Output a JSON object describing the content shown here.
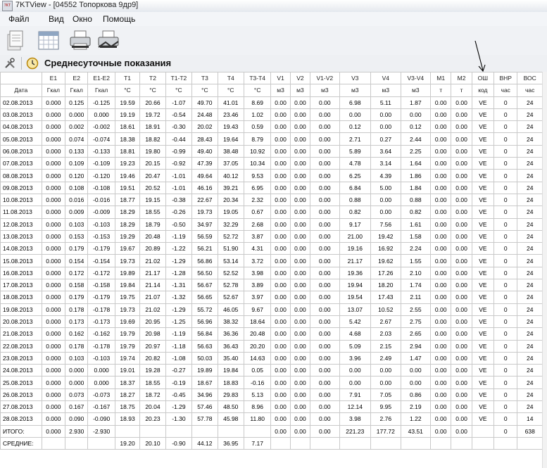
{
  "window": {
    "title": "7KTView - [04552 Топоркова 9др9]"
  },
  "menu": [
    "Файл",
    "Вид",
    "Окно",
    "Помощь"
  ],
  "toolbar": {
    "buttons": [
      "document-icon",
      "calendar-icon",
      "printer-icon",
      "print-preview-icon"
    ]
  },
  "report": {
    "title": "Среднесуточные показания"
  },
  "table": {
    "headers": [
      "",
      "E1",
      "E2",
      "E1-E2",
      "T1",
      "T2",
      "T1-T2",
      "T3",
      "T4",
      "T3-T4",
      "V1",
      "V2",
      "V1-V2",
      "V3",
      "V4",
      "V3-V4",
      "M1",
      "M2",
      "ОШ",
      "ВНР",
      "ВОС"
    ],
    "units": [
      "Дата",
      "Гкал",
      "Гкал",
      "Гкал",
      "°C",
      "°C",
      "°C",
      "°C",
      "°C",
      "°C",
      "м3",
      "м3",
      "м3",
      "м3",
      "м3",
      "м3",
      "т",
      "т",
      "код",
      "час",
      "час"
    ],
    "rows": [
      [
        "02.08.2013",
        "0.000",
        "0.125",
        "-0.125",
        "19.59",
        "20.66",
        "-1.07",
        "49.70",
        "41.01",
        "8.69",
        "0.00",
        "0.00",
        "0.00",
        "6.98",
        "5.11",
        "1.87",
        "0.00",
        "0.00",
        "VE",
        "0",
        "24"
      ],
      [
        "03.08.2013",
        "0.000",
        "0.000",
        "0.000",
        "19.19",
        "19.72",
        "-0.54",
        "24.48",
        "23.46",
        "1.02",
        "0.00",
        "0.00",
        "0.00",
        "0.00",
        "0.00",
        "0.00",
        "0.00",
        "0.00",
        "VE",
        "0",
        "24"
      ],
      [
        "04.08.2013",
        "0.000",
        "0.002",
        "-0.002",
        "18.61",
        "18.91",
        "-0.30",
        "20.02",
        "19.43",
        "0.59",
        "0.00",
        "0.00",
        "0.00",
        "0.12",
        "0.00",
        "0.12",
        "0.00",
        "0.00",
        "VE",
        "0",
        "24"
      ],
      [
        "05.08.2013",
        "0.000",
        "0.074",
        "-0.074",
        "18.38",
        "18.82",
        "-0.44",
        "28.43",
        "19.64",
        "8.79",
        "0.00",
        "0.00",
        "0.00",
        "2.71",
        "0.27",
        "2.44",
        "0.00",
        "0.00",
        "VE",
        "0",
        "24"
      ],
      [
        "06.08.2013",
        "0.000",
        "0.133",
        "-0.133",
        "18.81",
        "19.80",
        "-0.99",
        "49.40",
        "38.48",
        "10.92",
        "0.00",
        "0.00",
        "0.00",
        "5.89",
        "3.64",
        "2.25",
        "0.00",
        "0.00",
        "VE",
        "0",
        "24"
      ],
      [
        "07.08.2013",
        "0.000",
        "0.109",
        "-0.109",
        "19.23",
        "20.15",
        "-0.92",
        "47.39",
        "37.05",
        "10.34",
        "0.00",
        "0.00",
        "0.00",
        "4.78",
        "3.14",
        "1.64",
        "0.00",
        "0.00",
        "VE",
        "0",
        "24"
      ],
      [
        "08.08.2013",
        "0.000",
        "0.120",
        "-0.120",
        "19.46",
        "20.47",
        "-1.01",
        "49.64",
        "40.12",
        "9.53",
        "0.00",
        "0.00",
        "0.00",
        "6.25",
        "4.39",
        "1.86",
        "0.00",
        "0.00",
        "VE",
        "0",
        "24"
      ],
      [
        "09.08.2013",
        "0.000",
        "0.108",
        "-0.108",
        "19.51",
        "20.52",
        "-1.01",
        "46.16",
        "39.21",
        "6.95",
        "0.00",
        "0.00",
        "0.00",
        "6.84",
        "5.00",
        "1.84",
        "0.00",
        "0.00",
        "VE",
        "0",
        "24"
      ],
      [
        "10.08.2013",
        "0.000",
        "0.016",
        "-0.016",
        "18.77",
        "19.15",
        "-0.38",
        "22.67",
        "20.34",
        "2.32",
        "0.00",
        "0.00",
        "0.00",
        "0.88",
        "0.00",
        "0.88",
        "0.00",
        "0.00",
        "VE",
        "0",
        "24"
      ],
      [
        "11.08.2013",
        "0.000",
        "0.009",
        "-0.009",
        "18.29",
        "18.55",
        "-0.26",
        "19.73",
        "19.05",
        "0.67",
        "0.00",
        "0.00",
        "0.00",
        "0.82",
        "0.00",
        "0.82",
        "0.00",
        "0.00",
        "VE",
        "0",
        "24"
      ],
      [
        "12.08.2013",
        "0.000",
        "0.103",
        "-0.103",
        "18.29",
        "18.79",
        "-0.50",
        "34.97",
        "32.29",
        "2.68",
        "0.00",
        "0.00",
        "0.00",
        "9.17",
        "7.56",
        "1.61",
        "0.00",
        "0.00",
        "VE",
        "0",
        "24"
      ],
      [
        "13.08.2013",
        "0.000",
        "0.153",
        "-0.153",
        "19.29",
        "20.48",
        "-1.19",
        "56.59",
        "52.72",
        "3.87",
        "0.00",
        "0.00",
        "0.00",
        "21.00",
        "19.42",
        "1.58",
        "0.00",
        "0.00",
        "VE",
        "0",
        "24"
      ],
      [
        "14.08.2013",
        "0.000",
        "0.179",
        "-0.179",
        "19.67",
        "20.89",
        "-1.22",
        "56.21",
        "51.90",
        "4.31",
        "0.00",
        "0.00",
        "0.00",
        "19.16",
        "16.92",
        "2.24",
        "0.00",
        "0.00",
        "VE",
        "0",
        "24"
      ],
      [
        "15.08.2013",
        "0.000",
        "0.154",
        "-0.154",
        "19.73",
        "21.02",
        "-1.29",
        "56.86",
        "53.14",
        "3.72",
        "0.00",
        "0.00",
        "0.00",
        "21.17",
        "19.62",
        "1.55",
        "0.00",
        "0.00",
        "VE",
        "0",
        "24"
      ],
      [
        "16.08.2013",
        "0.000",
        "0.172",
        "-0.172",
        "19.89",
        "21.17",
        "-1.28",
        "56.50",
        "52.52",
        "3.98",
        "0.00",
        "0.00",
        "0.00",
        "19.36",
        "17.26",
        "2.10",
        "0.00",
        "0.00",
        "VE",
        "0",
        "24"
      ],
      [
        "17.08.2013",
        "0.000",
        "0.158",
        "-0.158",
        "19.84",
        "21.14",
        "-1.31",
        "56.67",
        "52.78",
        "3.89",
        "0.00",
        "0.00",
        "0.00",
        "19.94",
        "18.20",
        "1.74",
        "0.00",
        "0.00",
        "VE",
        "0",
        "24"
      ],
      [
        "18.08.2013",
        "0.000",
        "0.179",
        "-0.179",
        "19.75",
        "21.07",
        "-1.32",
        "56.65",
        "52.67",
        "3.97",
        "0.00",
        "0.00",
        "0.00",
        "19.54",
        "17.43",
        "2.11",
        "0.00",
        "0.00",
        "VE",
        "0",
        "24"
      ],
      [
        "19.08.2013",
        "0.000",
        "0.178",
        "-0.178",
        "19.73",
        "21.02",
        "-1.29",
        "55.72",
        "46.05",
        "9.67",
        "0.00",
        "0.00",
        "0.00",
        "13.07",
        "10.52",
        "2.55",
        "0.00",
        "0.00",
        "VE",
        "0",
        "24"
      ],
      [
        "20.08.2013",
        "0.000",
        "0.173",
        "-0.173",
        "19.69",
        "20.95",
        "-1.25",
        "56.96",
        "38.32",
        "18.64",
        "0.00",
        "0.00",
        "0.00",
        "5.42",
        "2.67",
        "2.75",
        "0.00",
        "0.00",
        "VE",
        "0",
        "24"
      ],
      [
        "21.08.2013",
        "0.000",
        "0.162",
        "-0.162",
        "19.79",
        "20.98",
        "-1.19",
        "56.84",
        "36.36",
        "20.48",
        "0.00",
        "0.00",
        "0.00",
        "4.68",
        "2.03",
        "2.65",
        "0.00",
        "0.00",
        "VE",
        "0",
        "24"
      ],
      [
        "22.08.2013",
        "0.000",
        "0.178",
        "-0.178",
        "19.79",
        "20.97",
        "-1.18",
        "56.63",
        "36.43",
        "20.20",
        "0.00",
        "0.00",
        "0.00",
        "5.09",
        "2.15",
        "2.94",
        "0.00",
        "0.00",
        "VE",
        "0",
        "24"
      ],
      [
        "23.08.2013",
        "0.000",
        "0.103",
        "-0.103",
        "19.74",
        "20.82",
        "-1.08",
        "50.03",
        "35.40",
        "14.63",
        "0.00",
        "0.00",
        "0.00",
        "3.96",
        "2.49",
        "1.47",
        "0.00",
        "0.00",
        "VE",
        "0",
        "24"
      ],
      [
        "24.08.2013",
        "0.000",
        "0.000",
        "0.000",
        "19.01",
        "19.28",
        "-0.27",
        "19.89",
        "19.84",
        "0.05",
        "0.00",
        "0.00",
        "0.00",
        "0.00",
        "0.00",
        "0.00",
        "0.00",
        "0.00",
        "VE",
        "0",
        "24"
      ],
      [
        "25.08.2013",
        "0.000",
        "0.000",
        "0.000",
        "18.37",
        "18.55",
        "-0.19",
        "18.67",
        "18.83",
        "-0.16",
        "0.00",
        "0.00",
        "0.00",
        "0.00",
        "0.00",
        "0.00",
        "0.00",
        "0.00",
        "VE",
        "0",
        "24"
      ],
      [
        "26.08.2013",
        "0.000",
        "0.073",
        "-0.073",
        "18.27",
        "18.72",
        "-0.45",
        "34.96",
        "29.83",
        "5.13",
        "0.00",
        "0.00",
        "0.00",
        "7.91",
        "7.05",
        "0.86",
        "0.00",
        "0.00",
        "VE",
        "0",
        "24"
      ],
      [
        "27.08.2013",
        "0.000",
        "0.167",
        "-0.167",
        "18.75",
        "20.04",
        "-1.29",
        "57.46",
        "48.50",
        "8.96",
        "0.00",
        "0.00",
        "0.00",
        "12.14",
        "9.95",
        "2.19",
        "0.00",
        "0.00",
        "VE",
        "0",
        "24"
      ],
      [
        "28.08.2013",
        "0.000",
        "0.090",
        "-0.090",
        "18.93",
        "20.23",
        "-1.30",
        "57.78",
        "45.98",
        "11.80",
        "0.00",
        "0.00",
        "0.00",
        "3.98",
        "2.76",
        "1.22",
        "0.00",
        "0.00",
        "VE",
        "0",
        "14"
      ]
    ],
    "total_row": [
      "ИТОГО:",
      "0.000",
      "2.930",
      "-2.930",
      "",
      "",
      "",
      "",
      "",
      "",
      "0.00",
      "0.00",
      "0.00",
      "221.23",
      "177.72",
      "43.51",
      "0.00",
      "0.00",
      "",
      "0",
      "638"
    ],
    "avg_row": [
      "СРЕДНИЕ:",
      "",
      "",
      "",
      "19.20",
      "20.10",
      "-0.90",
      "44.12",
      "36.95",
      "7.17",
      "",
      "",
      "",
      "",
      "",
      "",
      "",
      "",
      "",
      "",
      ""
    ]
  }
}
